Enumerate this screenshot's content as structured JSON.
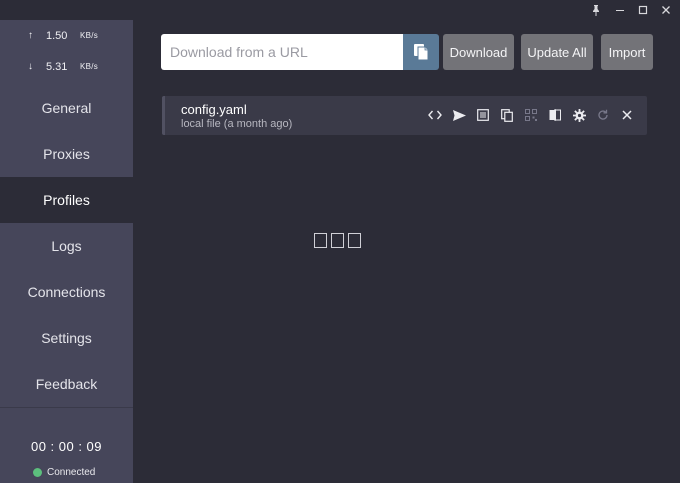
{
  "window": {
    "pin_icon": "pin-icon",
    "minimize_icon": "minimize-icon",
    "maximize_icon": "maximize-icon",
    "close_icon": "close-icon"
  },
  "traffic": {
    "upload": {
      "arrow": "↑",
      "value": "1.50",
      "unit": "KB/s"
    },
    "download": {
      "arrow": "↓",
      "value": "5.31",
      "unit": "KB/s"
    }
  },
  "nav": {
    "general": "General",
    "proxies": "Proxies",
    "profiles": "Profiles",
    "logs": "Logs",
    "connections": "Connections",
    "settings": "Settings",
    "feedback": "Feedback"
  },
  "status": {
    "timer": "00 : 00 : 09",
    "connection": "Connected",
    "dot_color": "#5cbf7d"
  },
  "toolbar": {
    "url_placeholder": "Download from a URL",
    "url_value": "",
    "download_label": "Download",
    "update_all_label": "Update All",
    "import_label": "Import"
  },
  "profile": {
    "name": "config.yaml",
    "subtitle": "local file (a month ago)",
    "actions": [
      "code-icon",
      "send-icon",
      "list-icon",
      "copy-icon",
      "qr-code-icon",
      "compare-icon",
      "gear-icon",
      "refresh-icon",
      "close-icon"
    ]
  },
  "accent_colors": {
    "paste_button": "#5a7a97",
    "sidebar": "#46465a",
    "main": "#2c2c37"
  }
}
